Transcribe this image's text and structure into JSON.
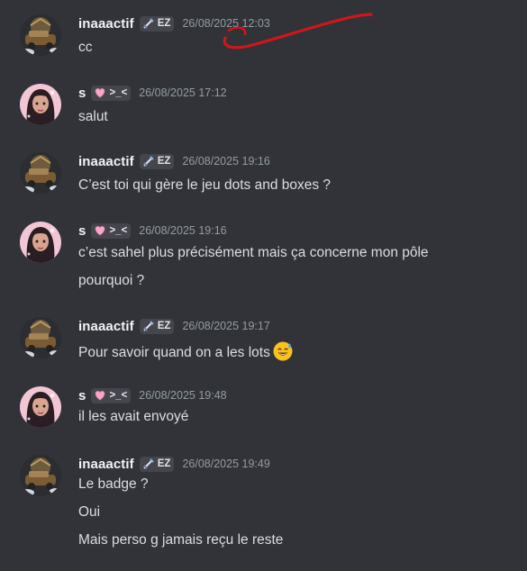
{
  "messages": [
    {
      "author": "inaaactif",
      "avatar": "car-avatar",
      "tag": {
        "icon": "sword-icon",
        "text": "EZ"
      },
      "timestamp": "26/08/2025 12:03",
      "lines": [
        "cc"
      ]
    },
    {
      "author": "s",
      "avatar": "girl-avatar",
      "tag": {
        "icon": "heart-icon",
        "text": ">_<"
      },
      "timestamp": "26/08/2025 17:12",
      "lines": [
        "salut"
      ]
    },
    {
      "author": "inaaactif",
      "avatar": "car-avatar",
      "tag": {
        "icon": "sword-icon",
        "text": "EZ"
      },
      "timestamp": "26/08/2025 19:16",
      "lines": [
        "C’est toi qui gère le jeu dots and boxes ?"
      ]
    },
    {
      "author": "s",
      "avatar": "girl-avatar",
      "tag": {
        "icon": "heart-icon",
        "text": ">_<"
      },
      "timestamp": "26/08/2025 19:16",
      "lines": [
        "c’est sahel plus précisément mais ça concerne mon pôle",
        "pourquoi ?"
      ]
    },
    {
      "author": "inaaactif",
      "avatar": "car-avatar",
      "tag": {
        "icon": "sword-icon",
        "text": "EZ"
      },
      "timestamp": "26/08/2025 19:17",
      "lines": [
        "Pour savoir quand on a les lots"
      ],
      "emoji": "sweat-smile-emoji"
    },
    {
      "author": "s",
      "avatar": "girl-avatar",
      "tag": {
        "icon": "heart-icon",
        "text": ">_<"
      },
      "timestamp": "26/08/2025 19:48",
      "lines": [
        "il les avait envoyé"
      ]
    },
    {
      "author": "inaaactif",
      "avatar": "car-avatar",
      "tag": {
        "icon": "sword-icon",
        "text": "EZ"
      },
      "timestamp": "26/08/2025 19:49",
      "lines": [
        "Le badge ?",
        "Oui",
        "Mais perso g jamais reçu le reste"
      ]
    }
  ],
  "colors": {
    "background": "#313338",
    "username": "#f2f3f5",
    "timestamp": "#949ba4",
    "text": "#dbdee1",
    "tag_background": "#45464d",
    "scribble": "#d2151b"
  }
}
